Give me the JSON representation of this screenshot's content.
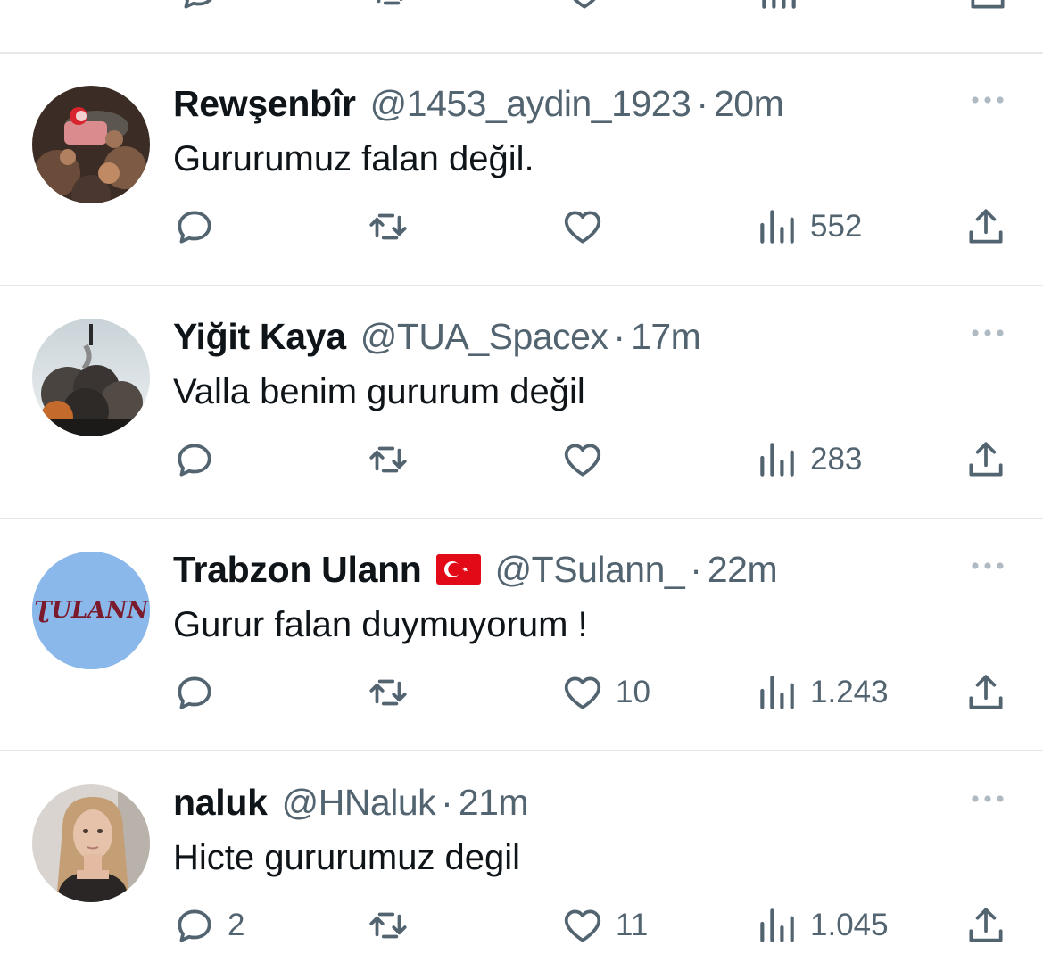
{
  "colors": {
    "text_primary": "#0f1419",
    "text_secondary": "#536471",
    "divider": "#e6e8ea",
    "avatar_blue": "#8bb8ea",
    "flag_red": "#e30a17"
  },
  "icons": [
    "reply-icon",
    "retweet-icon",
    "like-icon",
    "views-icon",
    "share-icon",
    "more-icon"
  ],
  "tweets": [
    {
      "name": "Rewşenbîr",
      "handle": "@1453_aydin_1923",
      "separator": "·",
      "time": "20m",
      "text": "Gururumuz falan değil.",
      "replies": "",
      "retweets": "",
      "likes": "",
      "views": "552"
    },
    {
      "name": "Yiğit Kaya",
      "handle": "@TUA_Spacex",
      "separator": "·",
      "time": "17m",
      "text": "Valla benim gururum değil",
      "replies": "",
      "retweets": "",
      "likes": "",
      "views": "283"
    },
    {
      "name": "Trabzon Ulann",
      "handle": "@TSulann_",
      "separator": "·",
      "time": "22m",
      "text": "Gurur falan duymuyorum !",
      "avatar_text": "ƮULANN",
      "replies": "",
      "retweets": "",
      "likes": "10",
      "views": "1.243"
    },
    {
      "name": "naluk",
      "handle": "@HNaluk",
      "separator": "·",
      "time": "21m",
      "text": "Hicte gururumuz degil",
      "replies": "2",
      "retweets": "",
      "likes": "11",
      "views": "1.045"
    }
  ]
}
